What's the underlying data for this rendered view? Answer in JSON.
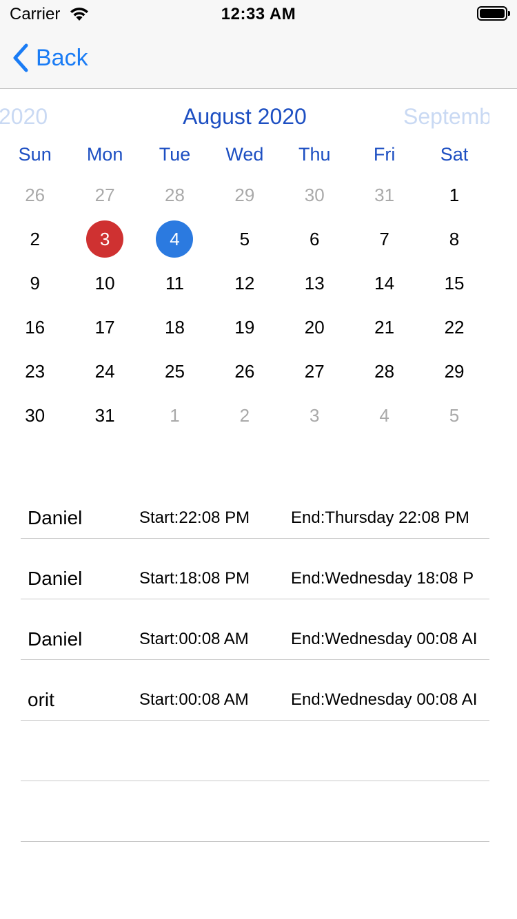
{
  "status_bar": {
    "carrier": "Carrier",
    "time": "12:33 AM"
  },
  "nav": {
    "back_label": "Back"
  },
  "calendar": {
    "prev_month": "2020",
    "current_month": "August 2020",
    "next_month": "Septemb",
    "weekdays": [
      "Sun",
      "Mon",
      "Tue",
      "Wed",
      "Thu",
      "Fri",
      "Sat"
    ],
    "today_color": "#cf3131",
    "selected_color": "#2b7ae0",
    "accent_color": "#1d4fc2",
    "days": [
      {
        "d": "26",
        "muted": true
      },
      {
        "d": "27",
        "muted": true
      },
      {
        "d": "28",
        "muted": true
      },
      {
        "d": "29",
        "muted": true
      },
      {
        "d": "30",
        "muted": true
      },
      {
        "d": "31",
        "muted": true
      },
      {
        "d": "1"
      },
      {
        "d": "2"
      },
      {
        "d": "3",
        "today": true
      },
      {
        "d": "4",
        "selected": true
      },
      {
        "d": "5"
      },
      {
        "d": "6"
      },
      {
        "d": "7"
      },
      {
        "d": "8"
      },
      {
        "d": "9"
      },
      {
        "d": "10"
      },
      {
        "d": "11"
      },
      {
        "d": "12"
      },
      {
        "d": "13"
      },
      {
        "d": "14"
      },
      {
        "d": "15"
      },
      {
        "d": "16"
      },
      {
        "d": "17"
      },
      {
        "d": "18"
      },
      {
        "d": "19"
      },
      {
        "d": "20"
      },
      {
        "d": "21"
      },
      {
        "d": "22"
      },
      {
        "d": "23"
      },
      {
        "d": "24"
      },
      {
        "d": "25"
      },
      {
        "d": "26"
      },
      {
        "d": "27"
      },
      {
        "d": "28"
      },
      {
        "d": "29"
      },
      {
        "d": "30"
      },
      {
        "d": "31"
      },
      {
        "d": "1",
        "muted": true
      },
      {
        "d": "2",
        "muted": true
      },
      {
        "d": "3",
        "muted": true
      },
      {
        "d": "4",
        "muted": true
      },
      {
        "d": "5",
        "muted": true
      }
    ]
  },
  "events": [
    {
      "name": "Daniel",
      "start": "Start:22:08 PM",
      "end": "End:Thursday 22:08 PM"
    },
    {
      "name": "Daniel",
      "start": "Start:18:08 PM",
      "end": "End:Wednesday 18:08 P"
    },
    {
      "name": "Daniel",
      "start": "Start:00:08 AM",
      "end": "End:Wednesday 00:08 AI"
    },
    {
      "name": "orit",
      "start": "Start:00:08 AM",
      "end": "End:Wednesday 00:08 AI"
    },
    {
      "name": "",
      "start": "",
      "end": ""
    },
    {
      "name": "",
      "start": "",
      "end": ""
    }
  ]
}
